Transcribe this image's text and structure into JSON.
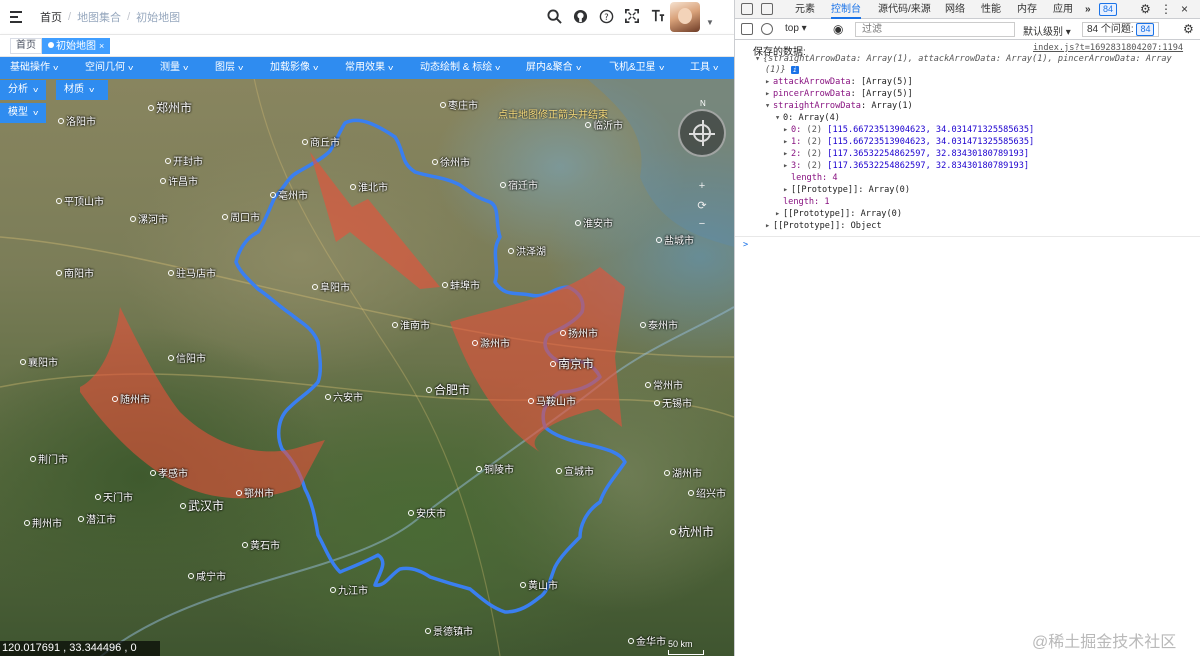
{
  "header": {
    "breadcrumb": [
      "首页",
      "地图集合",
      "初始地图"
    ]
  },
  "tags": {
    "home": "首页",
    "active": "初始地图"
  },
  "toolbar": {
    "items": [
      "基础操作",
      "空间几何",
      "测量",
      "图层",
      "加载影像",
      "常用效果",
      "动态绘制 & 标绘",
      "屏内&聚合",
      "飞机&卫星",
      "工具"
    ],
    "sub": [
      "分析",
      "材质",
      "模型"
    ]
  },
  "map": {
    "hint": "点击地图修正箭头并结束",
    "cities": {
      "zhengzhou": "郑州市",
      "luoyang": "洛阳市",
      "zaozhuang": "枣庄市",
      "linyi": "临沂市",
      "shangqiu": "商丘市",
      "xuzhou": "徐州市",
      "lianyungang": "连云港市",
      "kaifeng": "开封市",
      "xuchang": "许昌市",
      "bozhou": "亳州市",
      "huaibei": "淮北市",
      "suqian": "宿迁市",
      "pingdingshan": "平顶山市",
      "luohe": "漯河市",
      "zhoukou": "周口市",
      "huaian": "淮安市",
      "yancheng": "盐城市",
      "zhumadian": "驻马店市",
      "fuyang": "阜阳市",
      "bengbu": "蚌埠市",
      "nanyang": "南阳市",
      "huainan": "淮南市",
      "yangzhou": "扬州市",
      "taizhou": "泰州市",
      "chuzhou": "滁州市",
      "nanjing": "南京市",
      "xinyang": "信阳市",
      "xiangyang": "襄阳市",
      "changzhou": "常州市",
      "liuan": "六安市",
      "hefei": "合肥市",
      "maanshan": "马鞍山市",
      "wuxi": "无锡市",
      "suizhou": "随州市",
      "xiaogan": "孝感市",
      "tongling": "铜陵市",
      "xuancheng": "宣城市",
      "huzhou": "湖州市",
      "jingmen": "荆门市",
      "tianmen": "天门市",
      "wuhan": "武汉市",
      "jingzhou": "荆州市",
      "qianjiang": "潜江市",
      "ezhou": "鄂州市",
      "anqing": "安庆市",
      "hangzhou": "杭州市",
      "huangshi": "黄石市",
      "xianning": "咸宁市",
      "jiujiang": "九江市",
      "huangshan": "黄山市",
      "jingdezhen": "景德镇市",
      "jinhua": "金华市",
      "shaoxing": "绍兴市",
      "lake_hongze": "洪泽湖"
    },
    "compass_n": "N",
    "zoom_in": "+",
    "zoom_reset": "⟳",
    "zoom_out": "−",
    "coords": "120.017691 ,  33.344496 ,  0",
    "scale": "50 km"
  },
  "devtools": {
    "tabs": [
      "元素",
      "控制台",
      "源代码/来源",
      "网络",
      "性能",
      "内存",
      "应用"
    ],
    "more": "»",
    "badge_count": "84",
    "context": "top",
    "filter_placeholder": "过滤",
    "level": "默认级别",
    "issues": "84 个问题:",
    "issues_badge": "84",
    "log": {
      "label": "保存的数据:",
      "source": "index.js?t=1692831804207:1194",
      "summary": "{straightArrowData: Array(1), attackArrowData: Array(1), pincerArrowData: Array",
      "summary2": "(1)}",
      "attack": "attackArrowData",
      "attack_val": "[Array(5)]",
      "pincer": "pincerArrowData",
      "pincer_val": "[Array(5)]",
      "straight": "straightArrowData",
      "straight_val": "Array(1)",
      "row0": "0: Array(4)",
      "points": [
        {
          "idx": "0:",
          "len": "(2)",
          "val": "[115.66723513904623, 34.031471325585635]"
        },
        {
          "idx": "1:",
          "len": "(2)",
          "val": "[115.66723513904623, 34.031471325585635]"
        },
        {
          "idx": "2:",
          "len": "(2)",
          "val": "[117.36532254862597, 32.83430180789193]"
        },
        {
          "idx": "3:",
          "len": "(2)",
          "val": "[117.36532254862597, 32.83430180789193]"
        }
      ],
      "length4": "length: 4",
      "proto0": "[[Prototype]]: Array(0)",
      "length1": "length: 1",
      "proto1": "[[Prototype]]: Array(0)",
      "proto2": "[[Prototype]]: Object"
    },
    "prompt": ">"
  },
  "watermark": "@稀土掘金技术社区",
  "colors": {
    "toolbar": "#2f8cf0",
    "boundary": "#3a7ff0",
    "arrow": "#e8503a",
    "devtools_accent": "#1a73e8"
  }
}
